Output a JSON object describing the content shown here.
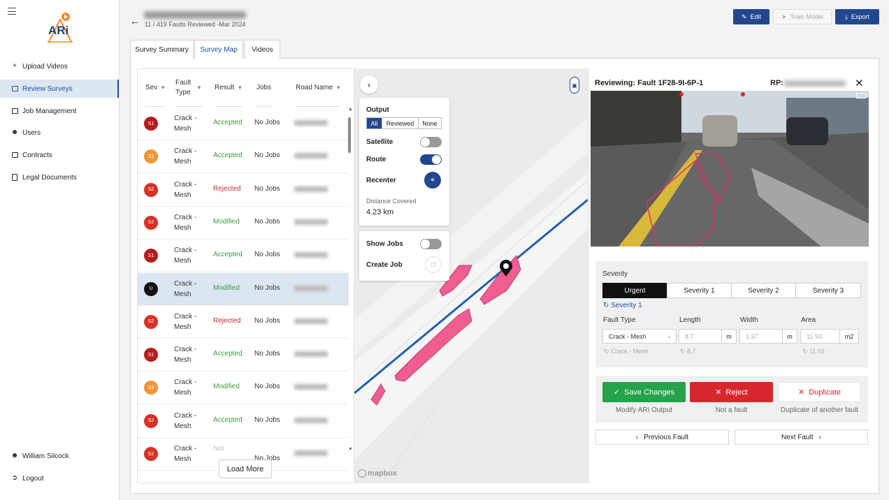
{
  "sidebar": {
    "logo_text": "ARi",
    "items": [
      {
        "label": "Upload Videos",
        "icon": "plus-icon"
      },
      {
        "label": "Review Surveys",
        "icon": "video-icon"
      },
      {
        "label": "Job Management",
        "icon": "folder-icon"
      },
      {
        "label": "Users",
        "icon": "user-icon"
      },
      {
        "label": "Contracts",
        "icon": "folder-icon"
      },
      {
        "label": "Legal Documents",
        "icon": "document-icon"
      }
    ],
    "user_name": "William Silcock",
    "logout_label": "Logout"
  },
  "header": {
    "subtitle": "11 / 419 Faults Reviewed -Mar 2024",
    "edit_label": "Edit",
    "train_label": "Train Model",
    "export_label": "Export"
  },
  "tabs": [
    "Survey Summary",
    "Survey Map",
    "Videos"
  ],
  "table": {
    "headers": {
      "sev": "Sev",
      "fault_type": "Fault Type",
      "result": "Result",
      "jobs": "Jobs",
      "road": "Road Name"
    },
    "rows": [
      {
        "sev": "S1",
        "sev_color": "#b71c1c",
        "type": "Crack - Mesh",
        "result": "Accepted",
        "result_color": "#3b9a3b",
        "jobs": "No Jobs"
      },
      {
        "sev": "S3",
        "sev_color": "#f09436",
        "type": "Crack - Mesh",
        "result": "Accepted",
        "result_color": "#3b9a3b",
        "jobs": "No Jobs"
      },
      {
        "sev": "S2",
        "sev_color": "#d93025",
        "type": "Crack - Mesh",
        "result": "Rejected",
        "result_color": "#c62828",
        "jobs": "No Jobs"
      },
      {
        "sev": "S2",
        "sev_color": "#d93025",
        "type": "Crack - Mesh",
        "result": "Modified",
        "result_color": "#3b9a3b",
        "jobs": "No Jobs"
      },
      {
        "sev": "S1",
        "sev_color": "#b71c1c",
        "type": "Crack - Mesh",
        "result": "Accepted",
        "result_color": "#3b9a3b",
        "jobs": "No Jobs"
      },
      {
        "sev": "U",
        "sev_color": "#111111",
        "type": "Crack - Mesh",
        "result": "Modified",
        "result_color": "#3b9a3b",
        "jobs": "No Jobs"
      },
      {
        "sev": "S2",
        "sev_color": "#d93025",
        "type": "Crack - Mesh",
        "result": "Rejected",
        "result_color": "#c62828",
        "jobs": "No Jobs"
      },
      {
        "sev": "S1",
        "sev_color": "#b71c1c",
        "type": "Crack - Mesh",
        "result": "Accepted",
        "result_color": "#3b9a3b",
        "jobs": "No Jobs"
      },
      {
        "sev": "S3",
        "sev_color": "#f09436",
        "type": "Crack - Mesh",
        "result": "Modified",
        "result_color": "#3b9a3b",
        "jobs": "No Jobs"
      },
      {
        "sev": "S2",
        "sev_color": "#d93025",
        "type": "Crack - Mesh",
        "result": "Accepted",
        "result_color": "#3b9a3b",
        "jobs": "No Jobs"
      },
      {
        "sev": "S2",
        "sev_color": "#d93025",
        "type": "Crack - Mesh",
        "result": "Not",
        "result_color": "#bbbbbb",
        "jobs": "No Jobs"
      }
    ],
    "load_more": "Load More"
  },
  "map": {
    "output_label": "Output",
    "output_options": [
      "All",
      "Reviewed",
      "None"
    ],
    "satellite_label": "Satellite",
    "route_label": "Route",
    "recenter_label": "Recenter",
    "distance_label": "Distance Covered",
    "distance_value": "4.23 km",
    "show_jobs_label": "Show Jobs",
    "create_job_label": "Create Job",
    "attribution": "mapbox",
    "satellite_on": false,
    "route_on": true,
    "show_jobs_on": false
  },
  "review": {
    "title": "Reviewing: Fault 1F28-9I-6P-1",
    "rp_label": "RP:",
    "severity_label": "Severity",
    "severity_tabs": [
      "Urgent",
      "Severity 1",
      "Severity 2",
      "Severity 3"
    ],
    "original_severity": "Severity 1",
    "fault_type_label": "Fault Type",
    "fault_type_value": "Crack - Mesh",
    "fault_type_original": "Crack - Mesh",
    "length_label": "Length",
    "length_value": "8.7",
    "length_unit": "m",
    "length_original": "8.7",
    "width_label": "Width",
    "width_value": "1.37",
    "width_unit": "m",
    "area_label": "Area",
    "area_value": "11.93",
    "area_unit": "m2",
    "area_original": "11.93",
    "save_label": "Save Changes",
    "save_caption": "Modify ARI Output",
    "reject_label": "Reject",
    "reject_caption": "Not a fault",
    "duplicate_label": "Duplicate",
    "duplicate_caption": "Duplicate of another fault",
    "prev_label": "Previous Fault",
    "next_label": "Next Fault"
  }
}
